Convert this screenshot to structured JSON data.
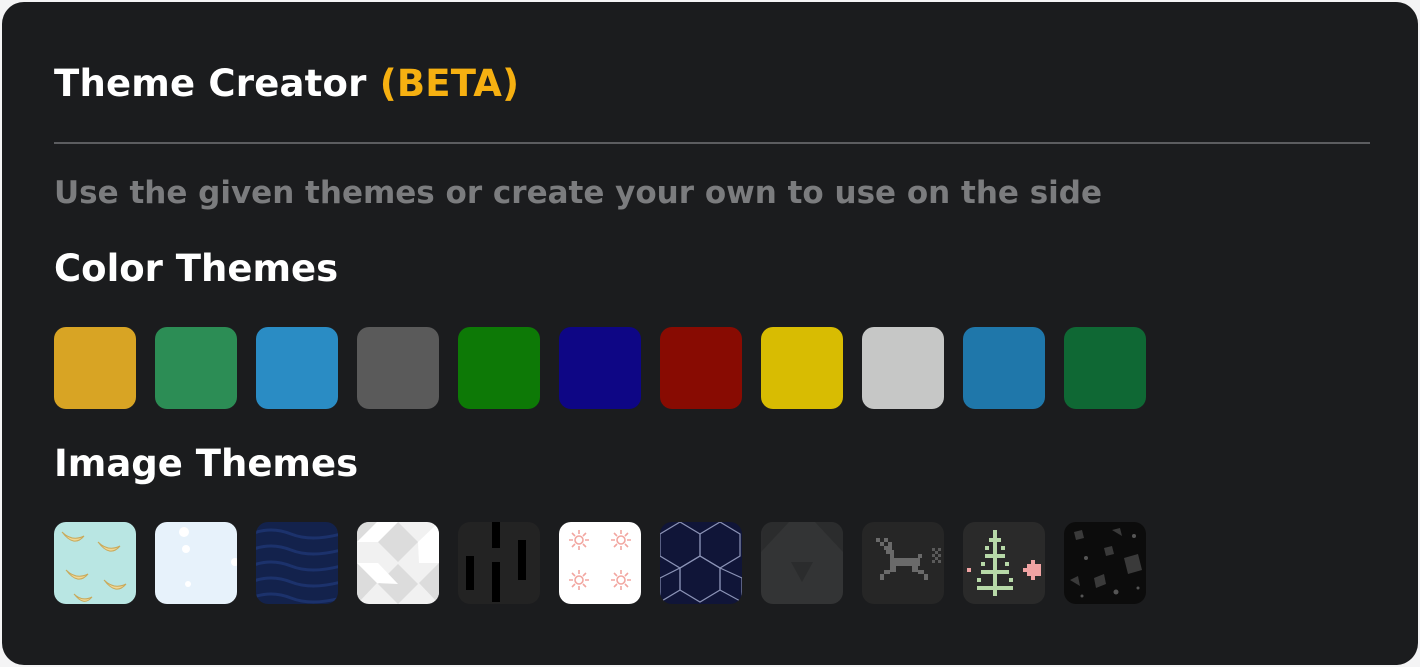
{
  "header": {
    "title": "Theme Creator",
    "beta_label": "(BETA)",
    "beta_color": "#f6b011"
  },
  "subtitle": "Use the given themes or create your own to use on the side",
  "color_themes": {
    "heading": "Color Themes",
    "swatches": [
      {
        "color": "#d8a424"
      },
      {
        "color": "#2c8d55"
      },
      {
        "color": "#2a8cc4"
      },
      {
        "color": "#5a5a5a"
      },
      {
        "color": "#0d7906"
      },
      {
        "color": "#0e0685"
      },
      {
        "color": "#880b02"
      },
      {
        "color": "#d8bc02"
      },
      {
        "color": "#c6c7c6"
      },
      {
        "color": "#1f77aa"
      },
      {
        "color": "#0f6834"
      }
    ]
  },
  "image_themes": {
    "heading": "Image Themes",
    "swatches": [
      {
        "name": "bananas-pattern",
        "background": "#b9e6e3"
      },
      {
        "name": "snow-pattern",
        "background": "#e7f2fb"
      },
      {
        "name": "navy-waves-pattern",
        "background": "#13224c"
      },
      {
        "name": "white-diamonds-pattern",
        "background": "#f1f1f1"
      },
      {
        "name": "black-bars-pattern",
        "background": "#232323"
      },
      {
        "name": "pink-suns-pattern",
        "background": "#ffffff"
      },
      {
        "name": "hexagon-lines-pattern",
        "background": "#101538"
      },
      {
        "name": "dark-fabric-pattern",
        "background": "#333435"
      },
      {
        "name": "pixel-reindeer-pattern",
        "background": "#262626"
      },
      {
        "name": "pixel-tree-pattern",
        "background": "#2a2a2a"
      },
      {
        "name": "terrazzo-pattern",
        "background": "#0c0c0c"
      }
    ]
  }
}
